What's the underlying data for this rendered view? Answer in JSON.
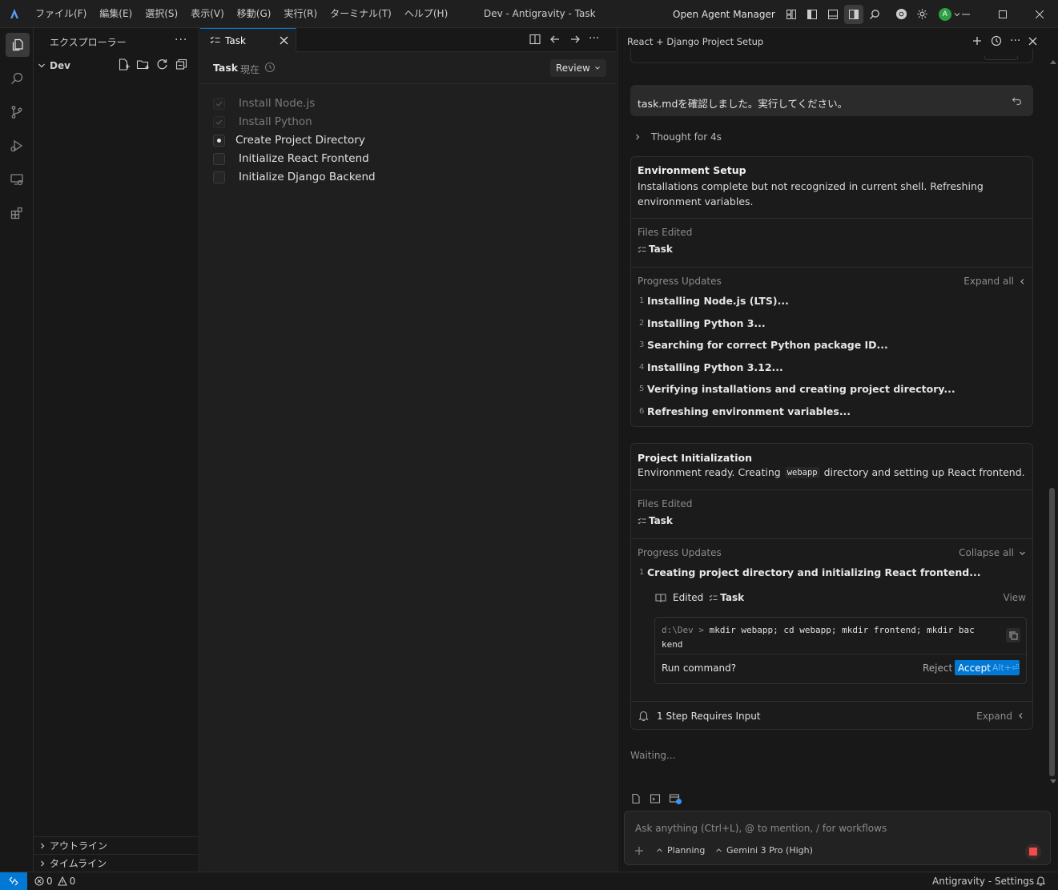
{
  "titlebar": {
    "menus": [
      "ファイル(F)",
      "編集(E)",
      "選択(S)",
      "表示(V)",
      "移動(G)",
      "実行(R)",
      "ターミナル(T)",
      "ヘルプ(H)"
    ],
    "window_title": "Dev - Antigravity - Task",
    "agent_manager_label": "Open Agent Manager",
    "avatar_letter": "A"
  },
  "sidebar": {
    "title": "エクスプローラー",
    "folder": "Dev",
    "outline_label": "アウトライン",
    "timeline_label": "タイムライン"
  },
  "editor": {
    "tab_label": "Task",
    "header_title": "Task",
    "header_subtitle": "現在",
    "review_label": "Review",
    "tasks": [
      {
        "label": "Install Node.js",
        "state": "done"
      },
      {
        "label": "Install Python",
        "state": "done"
      },
      {
        "label": "Create Project Directory",
        "state": "in-progress"
      },
      {
        "label": "Initialize React Frontend",
        "state": "todo"
      },
      {
        "label": "Initialize Django Backend",
        "state": "todo"
      }
    ]
  },
  "agent": {
    "panel_title": "React + Django Project Setup",
    "user_message": "task.mdを確認しました。実行してください。",
    "thought_label": "Thought for 4s",
    "env_card": {
      "title": "Environment Setup",
      "description": "Installations complete but not recognized in current shell. Refreshing environment variables.",
      "files_edited_label": "Files Edited",
      "file_name": "Task",
      "progress_label": "Progress Updates",
      "expand_label": "Expand all",
      "steps": [
        "Installing Node.js (LTS)...",
        "Installing Python 3...",
        "Searching for correct Python package ID...",
        "Installing Python 3.12...",
        "Verifying installations and creating project directory...",
        "Refreshing environment variables..."
      ]
    },
    "init_card": {
      "title": "Project Initialization",
      "description_before": "Environment ready. Creating",
      "description_code": "webapp",
      "description_after": "directory and setting up React frontend.",
      "files_edited_label": "Files Edited",
      "file_name": "Task",
      "progress_label": "Progress Updates",
      "collapse_label": "Collapse all",
      "step1": "Creating project directory and initializing React frontend...",
      "edited_label": "Edited",
      "edited_file": "Task",
      "view_label": "View",
      "command_prompt": "d:\\Dev >",
      "command_line1": "mkdir webapp; cd webapp; mkdir frontend; mkdir bac",
      "command_line2": "kend",
      "run_label": "Run command?",
      "reject_label": "Reject",
      "accept_label": "Accept",
      "accept_shortcut": "Alt+⏎",
      "requires_input_label": "1 Step Requires Input",
      "expand_label": "Expand"
    },
    "waiting_label": "Waiting...",
    "input_placeholder": "Ask anything (Ctrl+L), @ to mention, / for workflows",
    "mode_label": "Planning",
    "model_label": "Gemini 3 Pro (High)"
  },
  "statusbar": {
    "errors": "0",
    "warnings": "0",
    "right_label": "Antigravity - Settings"
  },
  "colors": {
    "accent": "#0078d4",
    "stop": "#f14c4c",
    "avatar": "#2ea043"
  }
}
